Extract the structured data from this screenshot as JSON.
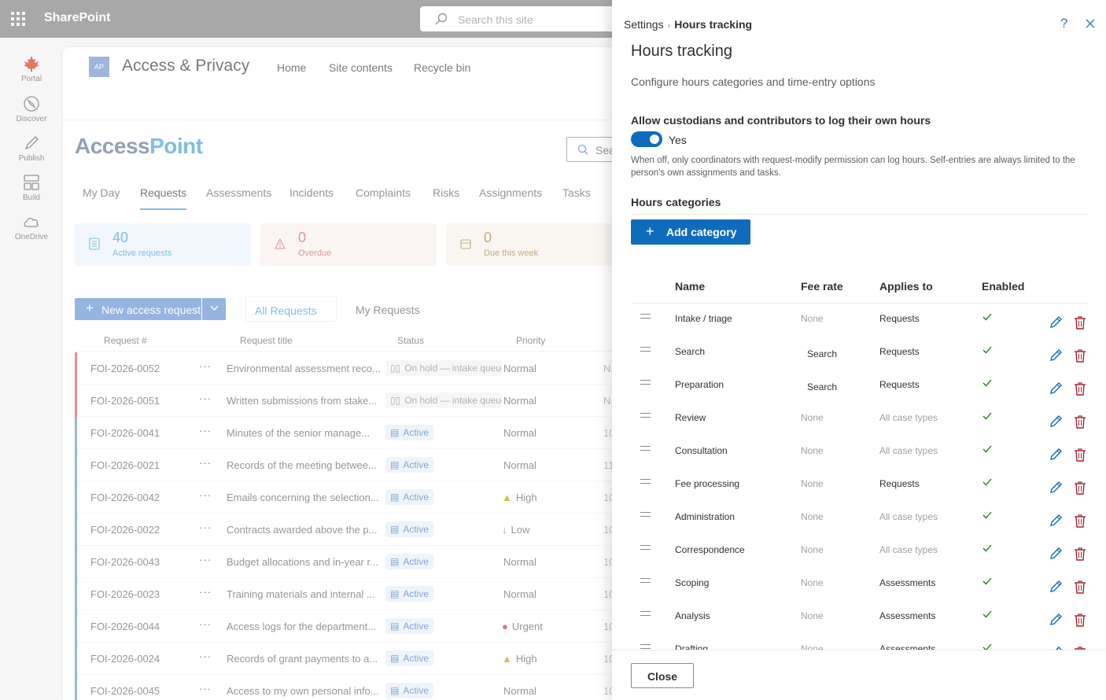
{
  "suite": {
    "app_name": "SharePoint",
    "search_placeholder": "Search this site"
  },
  "appbar": [
    {
      "label": "Portal",
      "icon": "maple-leaf-icon"
    },
    {
      "label": "Discover",
      "icon": "compass-icon"
    },
    {
      "label": "Publish",
      "icon": "pen-icon"
    },
    {
      "label": "Build",
      "icon": "layout-icon"
    },
    {
      "label": "OneDrive",
      "icon": "cloud-icon"
    }
  ],
  "site": {
    "logo_text": "AP",
    "name": "Access & Privacy",
    "nav": [
      "Home",
      "Site contents",
      "Recycle bin"
    ],
    "brand_a": "Access",
    "brand_b": "Point",
    "search_placeholder": "Sea",
    "tabs": [
      "My Day",
      "Requests",
      "Assessments",
      "Incidents",
      "Complaints",
      "Risks",
      "Assignments",
      "Tasks"
    ],
    "active_tab": "Requests",
    "cards": [
      {
        "value": "40",
        "label": "Active requests",
        "color": "#3c9ad6",
        "bg": "#eaf3fb"
      },
      {
        "value": "0",
        "label": "Overdue",
        "color": "#c4675f",
        "bg": "#f8eeed"
      },
      {
        "value": "0",
        "label": "Due this week",
        "color": "#a0804a",
        "bg": "#f6f1ea"
      }
    ],
    "new_button": "New access request",
    "views": [
      "All Requests",
      "My Requests"
    ],
    "columns": [
      "Request #",
      "Request title",
      "Status",
      "Priority"
    ],
    "rows": [
      {
        "id": "FOI-2026-0052",
        "title": "Environmental assessment reco...",
        "status": "On hold — intake queue",
        "status_type": "hold",
        "priority": "Normal",
        "prio_icon": "",
        "extra": "N,",
        "bar": "#d9534f"
      },
      {
        "id": "FOI-2026-0051",
        "title": "Written submissions from stake...",
        "status": "On hold — intake queue",
        "status_type": "hold",
        "priority": "Normal",
        "prio_icon": "",
        "extra": "N,",
        "bar": "#d9534f"
      },
      {
        "id": "FOI-2026-0041",
        "title": "Minutes of the senior manage...",
        "status": "Active",
        "status_type": "active",
        "priority": "Normal",
        "prio_icon": "",
        "extra": "10",
        "bar": "#5b8ed0"
      },
      {
        "id": "FOI-2026-0021",
        "title": "Records of the meeting betwee...",
        "status": "Active",
        "status_type": "active",
        "priority": "Normal",
        "prio_icon": "",
        "extra": "11",
        "bar": "#5b8ed0"
      },
      {
        "id": "FOI-2026-0042",
        "title": "Emails concerning the selection...",
        "status": "Active",
        "status_type": "active",
        "priority": "High",
        "prio_icon": "warning-icon",
        "extra": "10",
        "bar": "#5b8ed0"
      },
      {
        "id": "FOI-2026-0022",
        "title": "Contracts awarded above the p...",
        "status": "Active",
        "status_type": "active",
        "priority": "Low",
        "prio_icon": "arrow-down-icon",
        "extra": "10",
        "bar": "#5b8ed0"
      },
      {
        "id": "FOI-2026-0043",
        "title": "Budget allocations and in-year r...",
        "status": "Active",
        "status_type": "active",
        "priority": "Normal",
        "prio_icon": "",
        "extra": "10",
        "bar": "#5b8ed0"
      },
      {
        "id": "FOI-2026-0023",
        "title": "Training materials and internal ...",
        "status": "Active",
        "status_type": "active",
        "priority": "Normal",
        "prio_icon": "",
        "extra": "10",
        "bar": "#5b8ed0"
      },
      {
        "id": "FOI-2026-0044",
        "title": "Access logs for the department...",
        "status": "Active",
        "status_type": "active",
        "priority": "Urgent",
        "prio_icon": "urgent-icon",
        "extra": "10",
        "bar": "#5b8ed0"
      },
      {
        "id": "FOI-2026-0024",
        "title": "Records of grant payments to a...",
        "status": "Active",
        "status_type": "active",
        "priority": "High",
        "prio_icon": "warning-icon",
        "extra": "10",
        "bar": "#5b8ed0"
      },
      {
        "id": "FOI-2026-0045",
        "title": "Access to my own personal info...",
        "status": "Active",
        "status_type": "active",
        "priority": "Normal",
        "prio_icon": "",
        "extra": "10",
        "bar": "#5b8ed0"
      }
    ]
  },
  "panel": {
    "breadcrumb_root": "Settings",
    "breadcrumb_current": "Hours tracking",
    "help_glyph": "?",
    "title": "Hours tracking",
    "description": "Configure hours categories and time-entry options",
    "self_log_label": "Allow custodians and contributors to log their own hours",
    "self_log_value": "Yes",
    "self_log_on": true,
    "self_log_help": "When off, only coordinators with request-modify permission can log hours. Self-entries are always limited to the person's own assignments and tasks.",
    "categories_title": "Hours categories",
    "add_button": "Add category",
    "columns": [
      "Name",
      "Fee rate",
      "Applies to",
      "Enabled"
    ],
    "categories": [
      {
        "name": "Intake / triage",
        "fee": "None",
        "fee_set": false,
        "applies": "Requests",
        "enabled": true
      },
      {
        "name": "Search",
        "fee": "Search",
        "fee_set": true,
        "applies": "Requests",
        "enabled": true
      },
      {
        "name": "Preparation",
        "fee": "Search",
        "fee_set": true,
        "applies": "Requests",
        "enabled": true
      },
      {
        "name": "Review",
        "fee": "None",
        "fee_set": false,
        "applies": "All case types",
        "enabled": true
      },
      {
        "name": "Consultation",
        "fee": "None",
        "fee_set": false,
        "applies": "All case types",
        "enabled": true
      },
      {
        "name": "Fee processing",
        "fee": "None",
        "fee_set": false,
        "applies": "Requests",
        "enabled": true
      },
      {
        "name": "Administration",
        "fee": "None",
        "fee_set": false,
        "applies": "All case types",
        "enabled": true
      },
      {
        "name": "Correspondence",
        "fee": "None",
        "fee_set": false,
        "applies": "All case types",
        "enabled": true
      },
      {
        "name": "Scoping",
        "fee": "None",
        "fee_set": false,
        "applies": "Assessments",
        "enabled": true
      },
      {
        "name": "Analysis",
        "fee": "None",
        "fee_set": false,
        "applies": "Assessments",
        "enabled": true
      },
      {
        "name": "Drafting",
        "fee": "None",
        "fee_set": false,
        "applies": "Assessments",
        "enabled": true
      }
    ],
    "close_button": "Close"
  },
  "colors": {
    "accent": "#0f6cbd",
    "delete": "#a4262c",
    "check": "#107c10"
  }
}
